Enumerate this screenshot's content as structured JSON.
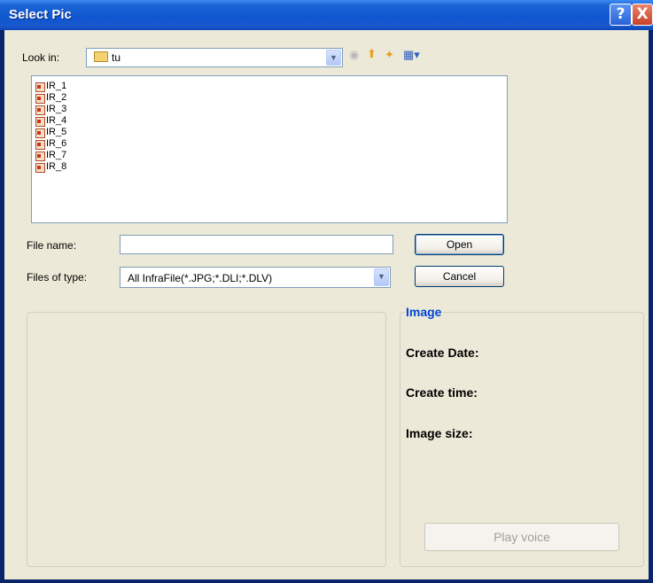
{
  "window": {
    "title": "Select Pic",
    "help_label": "?",
    "close_label": "X"
  },
  "look_in": {
    "label": "Look in:",
    "value": "tu"
  },
  "toolbar": {
    "icons": [
      "back-icon",
      "up-folder-icon",
      "new-folder-icon",
      "view-menu-icon"
    ]
  },
  "files": [
    {
      "name": "IR_1"
    },
    {
      "name": "IR_2"
    },
    {
      "name": "IR_3"
    },
    {
      "name": "IR_4"
    },
    {
      "name": "IR_5"
    },
    {
      "name": "IR_6"
    },
    {
      "name": "IR_7"
    },
    {
      "name": "IR_8"
    }
  ],
  "file_name": {
    "label": "File name:",
    "value": ""
  },
  "file_type": {
    "label": "Files of type:",
    "value": "All InfraFile(*.JPG;*.DLI;*.DLV)"
  },
  "buttons": {
    "open": "Open",
    "cancel": "Cancel",
    "play_voice": "Play voice"
  },
  "image_info": {
    "title": "Image",
    "create_date": "Create Date:",
    "create_time": "Create time:",
    "image_size": "Image size:"
  },
  "colors": {
    "titlebar": "#0f56d0",
    "client_bg": "#ece9d8",
    "group_title": "#0046d5"
  }
}
